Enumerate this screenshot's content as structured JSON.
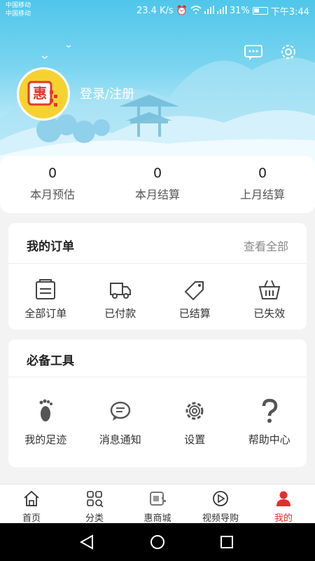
{
  "status_bar": {
    "carrier1": "中国移动",
    "carrier2": "中国移动",
    "speed": "23.4 K/s",
    "battery": "31%",
    "time": "下午3:44"
  },
  "header": {
    "login_label": "登录/注册",
    "logo_char": "惠"
  },
  "stats": [
    {
      "value": "0",
      "label": "本月预估"
    },
    {
      "value": "0",
      "label": "本月结算"
    },
    {
      "value": "0",
      "label": "上月结算"
    }
  ],
  "orders": {
    "title": "我的订单",
    "view_all": "查看全部",
    "items": [
      {
        "label": "全部订单",
        "icon": "document-icon"
      },
      {
        "label": "已付款",
        "icon": "truck-icon"
      },
      {
        "label": "已结算",
        "icon": "tag-icon"
      },
      {
        "label": "已失效",
        "icon": "basket-icon"
      }
    ]
  },
  "tools": {
    "title": "必备工具",
    "items": [
      {
        "label": "我的足迹",
        "icon": "footprint-icon"
      },
      {
        "label": "消息通知",
        "icon": "message-icon"
      },
      {
        "label": "设置",
        "icon": "gear-icon"
      },
      {
        "label": "帮助中心",
        "icon": "question-icon"
      }
    ]
  },
  "tabbar": {
    "items": [
      {
        "label": "首页",
        "icon": "home-icon"
      },
      {
        "label": "分类",
        "icon": "category-icon"
      },
      {
        "label": "惠商城",
        "icon": "mall-icon"
      },
      {
        "label": "视频导购",
        "icon": "play-icon"
      },
      {
        "label": "我的",
        "icon": "user-icon",
        "active": true
      }
    ],
    "active_color": "#e52d2d"
  }
}
